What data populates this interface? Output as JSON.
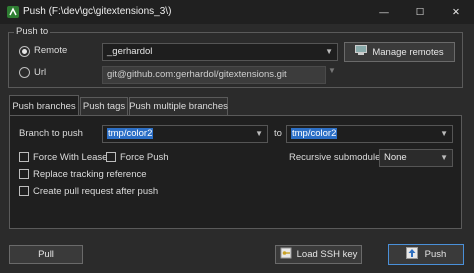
{
  "window": {
    "title": "Push (F:\\dev\\gc\\gitextensions_3\\)",
    "minimize_glyph": "—",
    "maximize_glyph": "☐",
    "close_glyph": "✕"
  },
  "push_to": {
    "legend": "Push to",
    "remote_label": "Remote",
    "remote_checked": true,
    "remote_value": "_gerhardol",
    "manage_remotes_label": "Manage remotes",
    "url_label": "Url",
    "url_checked": false,
    "url_value": "git@github.com:gerhardol/gitextensions.git"
  },
  "tabs": [
    {
      "label": "Push branches",
      "active": true
    },
    {
      "label": "Push tags",
      "active": false
    },
    {
      "label": "Push multiple branches",
      "active": false
    }
  ],
  "push_branches": {
    "branch_label": "Branch to push",
    "branch_value": "tmp/color2",
    "to_label": "to",
    "to_value": "tmp/color2",
    "force_with_lease": {
      "label": "Force With Lease",
      "checked": false
    },
    "force_push": {
      "label": "Force Push",
      "checked": false
    },
    "replace_tracking": {
      "label": "Replace tracking reference",
      "checked": false
    },
    "create_pr": {
      "label": "Create pull request after push",
      "checked": false
    },
    "recursive_label": "Recursive submodules",
    "recursive_value": "None"
  },
  "footer": {
    "pull_label": "Pull",
    "load_ssh_label": "Load SSH key",
    "push_label": "Push"
  },
  "icons": {
    "app": "git-extensions-icon",
    "manage_remotes": "manage-remotes-icon",
    "load_ssh": "key-icon",
    "push": "push-arrow-icon"
  }
}
